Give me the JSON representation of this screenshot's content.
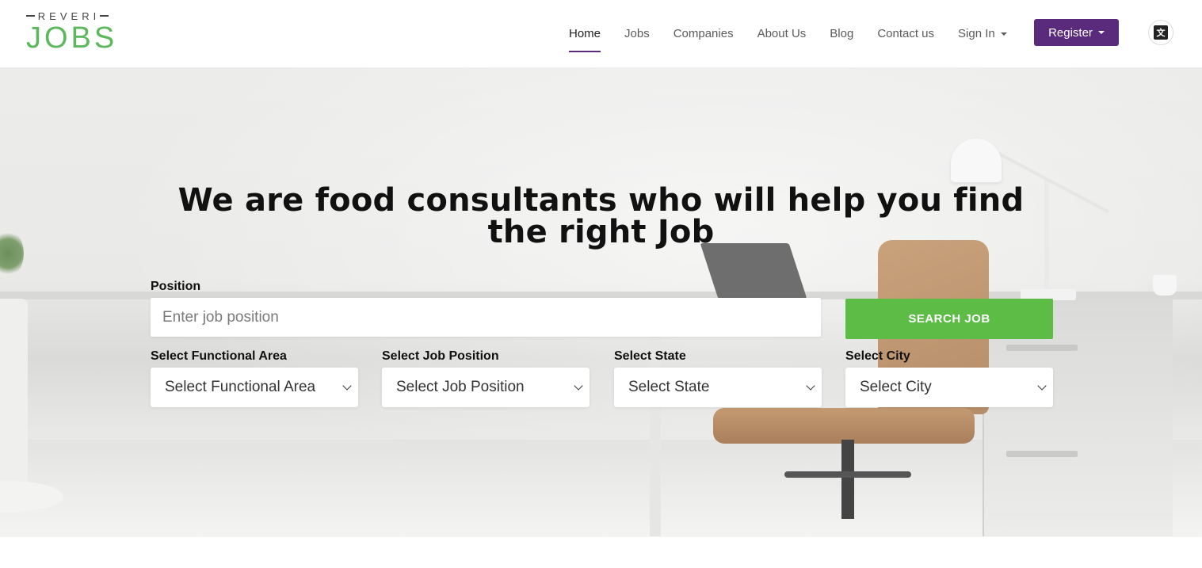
{
  "brand": {
    "logo_top": "REVERI",
    "logo_main": "JOBS",
    "accent_color": "#5cbc46",
    "primary_color": "#5a2a7d"
  },
  "nav": {
    "items": [
      {
        "label": "Home",
        "active": true
      },
      {
        "label": "Jobs",
        "active": false
      },
      {
        "label": "Companies",
        "active": false
      },
      {
        "label": "About Us",
        "active": false
      },
      {
        "label": "Blog",
        "active": false
      },
      {
        "label": "Contact us",
        "active": false
      },
      {
        "label": "Sign In",
        "active": false,
        "dropdown": true
      }
    ],
    "register_label": "Register",
    "language_icon": "translate-icon"
  },
  "hero": {
    "title": "We are food consultants who will help you find the right Job"
  },
  "search": {
    "position_label": "Position",
    "position_placeholder": "Enter job position",
    "button_label": "SEARCH JOB",
    "filters": [
      {
        "label": "Select Functional Area",
        "value": "Select Functional Area"
      },
      {
        "label": "Select Job Position",
        "value": "Select Job Position"
      },
      {
        "label": "Select State",
        "value": "Select State"
      },
      {
        "label": "Select City",
        "value": "Select City"
      }
    ]
  }
}
